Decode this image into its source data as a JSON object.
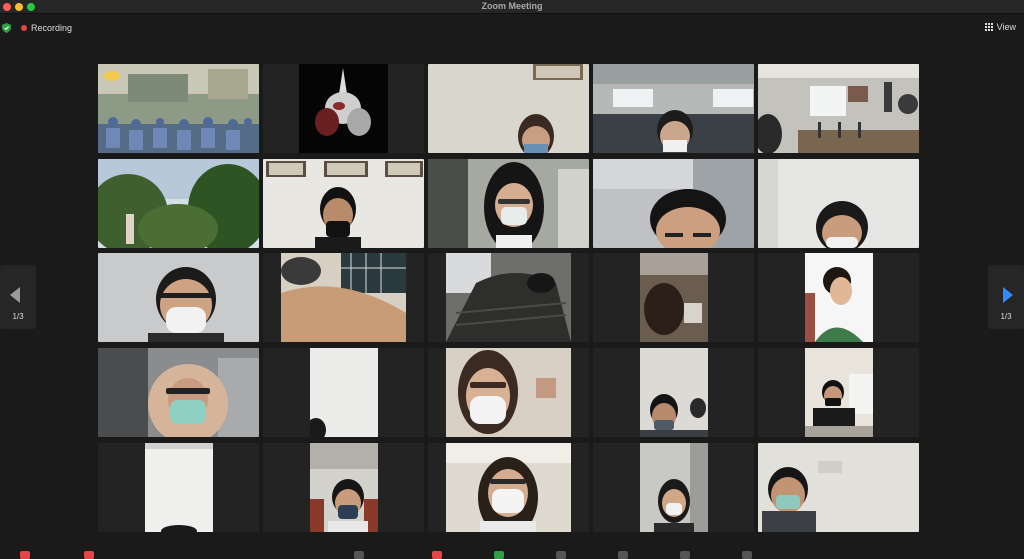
{
  "window": {
    "title": "Zoom Meeting"
  },
  "topbar": {
    "recording_label": "Recording",
    "view_label": "View"
  },
  "pagination": {
    "left_page": "1/3",
    "right_page": "1/3"
  },
  "colors": {
    "recording": "#e64545",
    "active_speaker": "#2f9e44",
    "next_arrow": "#2d8cff",
    "shield": "#2f9e44"
  },
  "icons": [
    "shield-icon",
    "recording-dot-icon",
    "grid-view-icon",
    "chevron-left-icon",
    "chevron-right-icon"
  ],
  "participants": [
    {
      "tile": "classroom-group"
    },
    {
      "tile": "anime-robot-avatar"
    },
    {
      "tile": "masked-woman-wall"
    },
    {
      "tile": "masked-man-office"
    },
    {
      "tile": "office-room"
    },
    {
      "tile": "forest-landscape"
    },
    {
      "tile": "masked-man-frames"
    },
    {
      "tile": "masked-woman-glasses"
    },
    {
      "tile": "man-closeup"
    },
    {
      "tile": "masked-woman-active"
    },
    {
      "tile": "woman-glasses-mask"
    },
    {
      "tile": "arm-closeup"
    },
    {
      "tile": "phone-call"
    },
    {
      "tile": "partial-face-dark"
    },
    {
      "tile": "woman-portrait"
    },
    {
      "tile": "hijab-woman"
    },
    {
      "tile": "partial-face-edge"
    },
    {
      "tile": "woman-glasses-white-mask"
    },
    {
      "tile": "masked-man-room"
    },
    {
      "tile": "man-black-shirt"
    },
    {
      "tile": "white-wall"
    },
    {
      "tile": "masked-man-blue"
    },
    {
      "tile": "woman-glasses-office"
    },
    {
      "tile": "masked-woman-corridor"
    },
    {
      "tile": "man-green-mask"
    }
  ]
}
